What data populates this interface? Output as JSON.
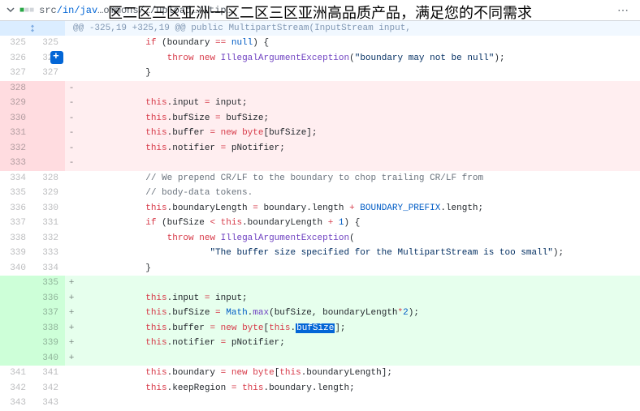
{
  "overlay_text": "区二区三区亚洲一区二区三区亚洲高品质产品，满足您的不同需求",
  "file_path_prefix": "src",
  "file_path_link": "/in/jav",
  "file_path_mid": "…",
  "file_path_rest": "ommons/…/upload…/ltip…",
  "hunk_header": "-325,19 +325,19",
  "hunk_context": "public MultipartStream(InputStream input,",
  "lines": [
    {
      "type": "ctx",
      "l": "325",
      "r": "325",
      "add": false,
      "html": "            <span class='kw'>if</span> (boundary <span class='kw'>==</span> <span class='id'>null</span>) {"
    },
    {
      "type": "ctx",
      "l": "326",
      "r": "326",
      "add": true,
      "html": "                <span class='kw'>throw</span> <span class='kw'>new</span> <span class='mth'>IllegalArgumentException</span>(<span class='str'>\"boundary may not be null\"</span>);"
    },
    {
      "type": "ctx",
      "l": "327",
      "r": "327",
      "add": false,
      "html": "            }"
    },
    {
      "type": "del",
      "l": "328",
      "r": "",
      "add": false,
      "html": ""
    },
    {
      "type": "del",
      "l": "329",
      "r": "",
      "add": false,
      "html": "            <span class='kw'>this</span>.input <span class='kw'>=</span> input;"
    },
    {
      "type": "del",
      "l": "330",
      "r": "",
      "add": false,
      "html": "            <span class='kw'>this</span>.bufSize <span class='kw'>=</span> bufSize;"
    },
    {
      "type": "del",
      "l": "331",
      "r": "",
      "add": false,
      "html": "            <span class='kw'>this</span>.buffer <span class='kw'>=</span> <span class='kw'>new</span> <span class='kw'>byte</span>[bufSize];"
    },
    {
      "type": "del",
      "l": "332",
      "r": "",
      "add": false,
      "html": "            <span class='kw'>this</span>.notifier <span class='kw'>=</span> pNotifier;"
    },
    {
      "type": "del",
      "l": "333",
      "r": "",
      "add": false,
      "html": ""
    },
    {
      "type": "ctx",
      "l": "334",
      "r": "328",
      "add": false,
      "html": "            <span class='cmt'>// We prepend CR/LF to the boundary to chop trailing CR/LF from</span>"
    },
    {
      "type": "ctx",
      "l": "335",
      "r": "329",
      "add": false,
      "html": "            <span class='cmt'>// body-data tokens.</span>"
    },
    {
      "type": "ctx",
      "l": "336",
      "r": "330",
      "add": false,
      "html": "            <span class='kw'>this</span>.boundaryLength <span class='kw'>=</span> boundary.length <span class='kw'>+</span> <span class='id'>BOUNDARY_PREFIX</span>.length;"
    },
    {
      "type": "ctx",
      "l": "337",
      "r": "331",
      "add": false,
      "html": "            <span class='kw'>if</span> (bufSize <span class='kw'>&lt;</span> <span class='kw'>this</span>.boundaryLength <span class='kw'>+</span> <span class='id'>1</span>) {"
    },
    {
      "type": "ctx",
      "l": "338",
      "r": "332",
      "add": false,
      "html": "                <span class='kw'>throw</span> <span class='kw'>new</span> <span class='mth'>IllegalArgumentException</span>("
    },
    {
      "type": "ctx",
      "l": "339",
      "r": "333",
      "add": false,
      "html": "                        <span class='str'>\"The buffer size specified for the MultipartStream is too small\"</span>);"
    },
    {
      "type": "ctx",
      "l": "340",
      "r": "334",
      "add": false,
      "html": "            }"
    },
    {
      "type": "ins",
      "l": "",
      "r": "335",
      "add": false,
      "html": ""
    },
    {
      "type": "ins",
      "l": "",
      "r": "336",
      "add": false,
      "html": "            <span class='kw'>this</span>.input <span class='kw'>=</span> input;"
    },
    {
      "type": "ins",
      "l": "",
      "r": "337",
      "add": false,
      "html": "            <span class='kw'>this</span>.bufSize <span class='kw'>=</span> <span class='id'>Math</span>.<span class='mth'>max</span>(bufSize, boundaryLength<span class='kw'>*</span><span class='id'>2</span>);"
    },
    {
      "type": "ins",
      "l": "",
      "r": "338",
      "add": false,
      "html": "            <span class='kw'>this</span>.buffer <span class='kw'>=</span> <span class='kw'>new</span> <span class='kw'>byte</span>[<span class='kw'>this</span>.<span class='hl'>bufSize</span>];"
    },
    {
      "type": "ins",
      "l": "",
      "r": "339",
      "add": false,
      "html": "            <span class='kw'>this</span>.notifier <span class='kw'>=</span> pNotifier;"
    },
    {
      "type": "ins",
      "l": "",
      "r": "340",
      "add": false,
      "html": ""
    },
    {
      "type": "ctx",
      "l": "341",
      "r": "341",
      "add": false,
      "html": "            <span class='kw'>this</span>.boundary <span class='kw'>=</span> <span class='kw'>new</span> <span class='kw'>byte</span>[<span class='kw'>this</span>.boundaryLength];"
    },
    {
      "type": "ctx",
      "l": "342",
      "r": "342",
      "add": false,
      "html": "            <span class='kw'>this</span>.keepRegion <span class='kw'>=</span> <span class='kw'>this</span>.boundary.length;"
    },
    {
      "type": "ctx",
      "l": "343",
      "r": "343",
      "add": false,
      "html": ""
    }
  ],
  "marks": {
    "del": "-",
    "ins": "+",
    "ctx": " "
  }
}
